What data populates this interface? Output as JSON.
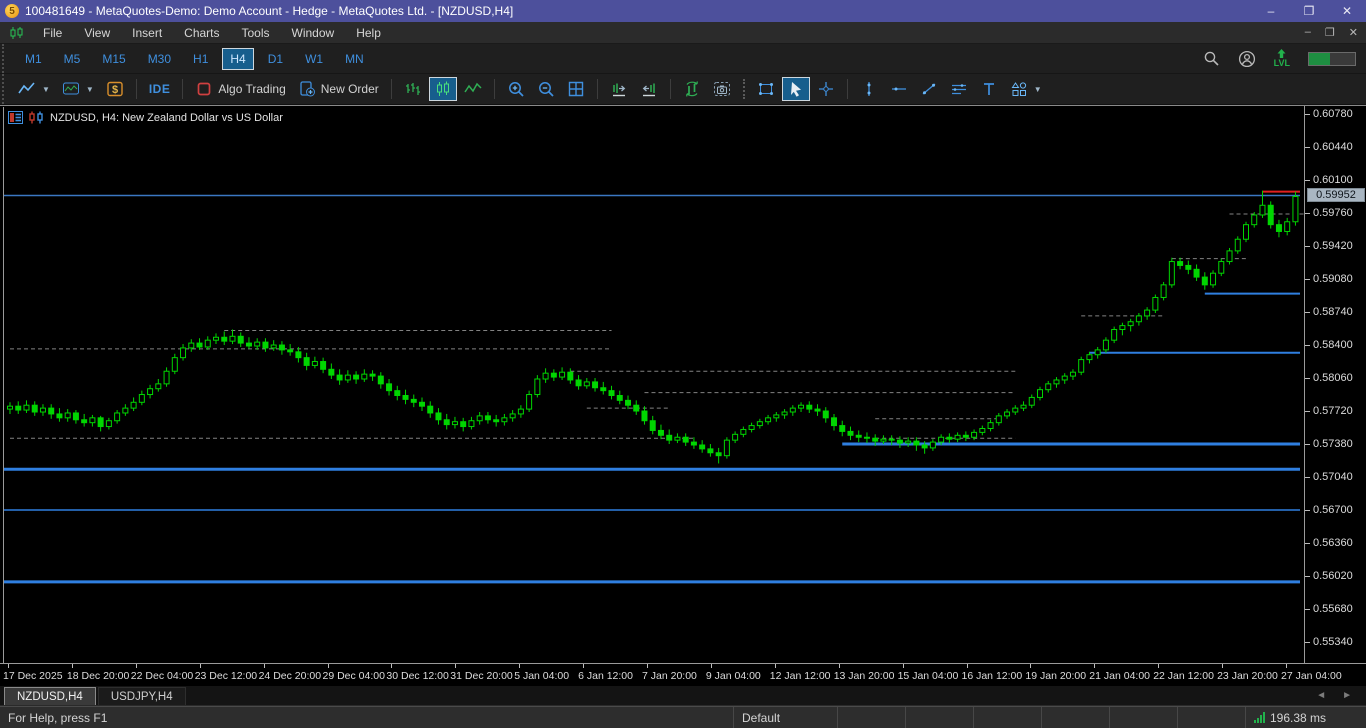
{
  "title_bar": {
    "title": "100481649 - MetaQuotes-Demo: Demo Account - Hedge - MetaQuotes Ltd. - [NZDUSD,H4]",
    "app_logo_text": "5",
    "controls": [
      "–",
      "❐",
      "✕"
    ]
  },
  "menu_bar": {
    "items": [
      "File",
      "View",
      "Insert",
      "Charts",
      "Tools",
      "Window",
      "Help"
    ],
    "child_controls": [
      "–",
      "❐",
      "✕"
    ]
  },
  "timeframe_bar": {
    "items": [
      "M1",
      "M5",
      "M15",
      "M30",
      "H1",
      "H4",
      "D1",
      "W1",
      "MN"
    ],
    "active": "H4"
  },
  "toolbar": {
    "items": [
      {
        "icon": "chart-type-icon",
        "dropdown": true
      },
      {
        "icon": "indicators-icon",
        "dropdown": true
      },
      {
        "icon": "dollar-icon"
      },
      {
        "sep": "line"
      },
      {
        "label": "IDE",
        "name": "ide-button",
        "label_class": "ide-label"
      },
      {
        "sep": "line"
      },
      {
        "icon": "algo-trading-icon",
        "label": "Algo Trading",
        "name": "algo-trading-button"
      },
      {
        "icon": "new-order-icon",
        "label": "New Order",
        "name": "new-order-button"
      },
      {
        "sep": "line"
      },
      {
        "icon": "bars-icon"
      },
      {
        "icon": "candles-icon",
        "active": true
      },
      {
        "icon": "line-chart-icon"
      },
      {
        "sep": "line"
      },
      {
        "icon": "zoom-in-icon"
      },
      {
        "icon": "zoom-out-icon"
      },
      {
        "icon": "tile-windows-icon"
      },
      {
        "sep": "line"
      },
      {
        "icon": "shift-end-icon"
      },
      {
        "icon": "shift-left-icon"
      },
      {
        "sep": "line"
      },
      {
        "icon": "auto-scroll-icon"
      },
      {
        "icon": "camera-icon"
      },
      {
        "sep": "dotted"
      },
      {
        "icon": "select-rect-icon"
      },
      {
        "icon": "cursor-icon",
        "active": true
      },
      {
        "icon": "crosshair-icon"
      },
      {
        "sep": "line"
      },
      {
        "icon": "vertical-line-icon"
      },
      {
        "icon": "horizontal-line-icon"
      },
      {
        "icon": "trendline-icon"
      },
      {
        "icon": "channel-icon"
      },
      {
        "icon": "text-icon"
      },
      {
        "icon": "shapes-icon",
        "dropdown": true
      }
    ],
    "right_icons": [
      "search-icon",
      "profile-icon"
    ],
    "level_label": "LVL",
    "progress_percent": 45
  },
  "chart": {
    "header": "NZDUSD, H4:  New Zealand Dollar vs US Dollar",
    "header_icons": [
      "depth-of-market-icon",
      "one-click-trading-icon"
    ],
    "price_badge": "0.59952",
    "colors": {
      "background": "#000000",
      "bull_fill": "#000000",
      "candle_green": "#00d600",
      "level_blue": "#2f7fe0",
      "current_price_blue": "#3b77c2",
      "alert_red": "#e02020",
      "dashed_gray": "#9a9a9a",
      "badge_bg": "#a9b6c2"
    }
  },
  "chart_data": {
    "type": "candlestick",
    "symbol": "NZDUSD",
    "timeframe": "H4",
    "price_axis": {
      "max": 0.6078,
      "min": 0.5534,
      "step": 0.0034,
      "labels": [
        "0.60780",
        "0.60440",
        "0.60100",
        "0.59760",
        "0.59420",
        "0.59080",
        "0.58740",
        "0.58400",
        "0.58060",
        "0.57720",
        "0.57380",
        "0.57040",
        "0.56700",
        "0.56360",
        "0.56020",
        "0.55680",
        "0.55340"
      ]
    },
    "time_axis": {
      "labels": [
        "17 Dec 2025",
        "18 Dec 20:00",
        "22 Dec 04:00",
        "23 Dec 12:00",
        "24 Dec 20:00",
        "29 Dec 04:00",
        "30 Dec 12:00",
        "31 Dec 20:00",
        "5 Jan 04:00",
        "6 Jan 12:00",
        "7 Jan 20:00",
        "9 Jan 04:00",
        "12 Jan 12:00",
        "13 Jan 20:00",
        "15 Jan 04:00",
        "16 Jan 12:00",
        "19 Jan 20:00",
        "21 Jan 04:00",
        "22 Jan 12:00",
        "23 Jan 20:00",
        "27 Jan 04:00"
      ]
    },
    "current_price": 0.59952,
    "levels": [
      {
        "price": 0.5995,
        "i1": null,
        "i2": null,
        "color": "#3b77c2",
        "width": 1.5,
        "note": "current price line"
      },
      {
        "price": 0.5999,
        "i1": 152,
        "i2": null,
        "color": "#e02020",
        "width": 2,
        "note": "red alert segment"
      },
      {
        "price": 0.5894,
        "i1": 145,
        "i2": null,
        "color": "#2f7fe0",
        "width": 2
      },
      {
        "price": 0.5833,
        "i1": 131,
        "i2": null,
        "color": "#2f7fe0",
        "width": 2
      },
      {
        "price": 0.5739,
        "i1": 101,
        "i2": null,
        "color": "#2f7fe0",
        "width": 3
      },
      {
        "price": 0.5713,
        "i1": null,
        "i2": null,
        "color": "#2f7fe0",
        "width": 3
      },
      {
        "price": 0.5671,
        "i1": null,
        "i2": null,
        "color": "#2f7fe0",
        "width": 1.5
      },
      {
        "price": 0.5597,
        "i1": null,
        "i2": null,
        "color": "#2f7fe0",
        "width": 3
      }
    ],
    "dashed_segments": [
      {
        "price": 0.5856,
        "i1": 26,
        "i2": 73
      },
      {
        "price": 0.5837,
        "i1": 0,
        "i2": 73
      },
      {
        "price": 0.5814,
        "i1": 68,
        "i2": 122
      },
      {
        "price": 0.5792,
        "i1": 77,
        "i2": 122
      },
      {
        "price": 0.5776,
        "i1": 70,
        "i2": 80
      },
      {
        "price": 0.5745,
        "i1": 0,
        "i2": 83
      },
      {
        "price": 0.5765,
        "i1": 105,
        "i2": 120
      },
      {
        "price": 0.5745,
        "i1": 105,
        "i2": 122
      },
      {
        "price": 0.5871,
        "i1": 130,
        "i2": 140
      },
      {
        "price": 0.593,
        "i1": 141,
        "i2": 150
      },
      {
        "price": 0.5976,
        "i1": 148,
        "i2": 157
      }
    ],
    "candles": [
      [
        0.5775,
        0.5782,
        0.577,
        0.5778
      ],
      [
        0.5778,
        0.5783,
        0.577,
        0.5774
      ],
      [
        0.5774,
        0.5784,
        0.5771,
        0.5779
      ],
      [
        0.5779,
        0.5783,
        0.5768,
        0.5772
      ],
      [
        0.5772,
        0.578,
        0.5768,
        0.5776
      ],
      [
        0.5776,
        0.578,
        0.5765,
        0.577
      ],
      [
        0.577,
        0.5776,
        0.5762,
        0.5766
      ],
      [
        0.5766,
        0.5775,
        0.5762,
        0.5771
      ],
      [
        0.5771,
        0.5774,
        0.576,
        0.5764
      ],
      [
        0.5764,
        0.577,
        0.5757,
        0.5761
      ],
      [
        0.5761,
        0.5769,
        0.5757,
        0.5766
      ],
      [
        0.5766,
        0.5768,
        0.5752,
        0.5757
      ],
      [
        0.5757,
        0.5766,
        0.5754,
        0.5763
      ],
      [
        0.5763,
        0.5774,
        0.576,
        0.5771
      ],
      [
        0.5771,
        0.578,
        0.5768,
        0.5776
      ],
      [
        0.5776,
        0.5787,
        0.5773,
        0.5782
      ],
      [
        0.5782,
        0.5794,
        0.5779,
        0.579
      ],
      [
        0.579,
        0.58,
        0.5786,
        0.5796
      ],
      [
        0.5796,
        0.5806,
        0.5793,
        0.5801
      ],
      [
        0.5801,
        0.5818,
        0.5798,
        0.5814
      ],
      [
        0.5814,
        0.5832,
        0.5811,
        0.5828
      ],
      [
        0.5828,
        0.5842,
        0.5825,
        0.5838
      ],
      [
        0.5838,
        0.5847,
        0.5834,
        0.5843
      ],
      [
        0.5843,
        0.5848,
        0.5836,
        0.5839
      ],
      [
        0.5839,
        0.585,
        0.5836,
        0.5846
      ],
      [
        0.5846,
        0.5853,
        0.5842,
        0.5849
      ],
      [
        0.5849,
        0.5855,
        0.5841,
        0.5845
      ],
      [
        0.5845,
        0.5857,
        0.5842,
        0.585
      ],
      [
        0.585,
        0.5854,
        0.5839,
        0.5843
      ],
      [
        0.5843,
        0.5849,
        0.5837,
        0.584
      ],
      [
        0.584,
        0.5848,
        0.5836,
        0.5844
      ],
      [
        0.5844,
        0.5848,
        0.5834,
        0.5838
      ],
      [
        0.5838,
        0.5846,
        0.5835,
        0.5841
      ],
      [
        0.5841,
        0.5845,
        0.5831,
        0.5836
      ],
      [
        0.5836,
        0.5842,
        0.583,
        0.5834
      ],
      [
        0.5834,
        0.5839,
        0.5823,
        0.5828
      ],
      [
        0.5828,
        0.5833,
        0.5815,
        0.582
      ],
      [
        0.582,
        0.5829,
        0.5817,
        0.5824
      ],
      [
        0.5824,
        0.5828,
        0.5812,
        0.5816
      ],
      [
        0.5816,
        0.5822,
        0.5806,
        0.581
      ],
      [
        0.581,
        0.5816,
        0.58,
        0.5805
      ],
      [
        0.5805,
        0.5815,
        0.5802,
        0.581
      ],
      [
        0.581,
        0.5814,
        0.5801,
        0.5806
      ],
      [
        0.5806,
        0.5816,
        0.5803,
        0.5811
      ],
      [
        0.5811,
        0.5815,
        0.5804,
        0.5809
      ],
      [
        0.5809,
        0.5813,
        0.5796,
        0.5801
      ],
      [
        0.5801,
        0.5806,
        0.5789,
        0.5794
      ],
      [
        0.5794,
        0.5799,
        0.5784,
        0.5789
      ],
      [
        0.5789,
        0.5795,
        0.578,
        0.5785
      ],
      [
        0.5785,
        0.579,
        0.5777,
        0.5782
      ],
      [
        0.5782,
        0.5787,
        0.5773,
        0.5778
      ],
      [
        0.5778,
        0.5783,
        0.5766,
        0.5771
      ],
      [
        0.5771,
        0.5776,
        0.5759,
        0.5764
      ],
      [
        0.5764,
        0.577,
        0.5754,
        0.5759
      ],
      [
        0.5759,
        0.5767,
        0.5755,
        0.5762
      ],
      [
        0.5762,
        0.5766,
        0.5752,
        0.5757
      ],
      [
        0.5757,
        0.5767,
        0.5754,
        0.5763
      ],
      [
        0.5763,
        0.5772,
        0.5759,
        0.5768
      ],
      [
        0.5768,
        0.5772,
        0.576,
        0.5764
      ],
      [
        0.5764,
        0.5769,
        0.5757,
        0.5762
      ],
      [
        0.5762,
        0.577,
        0.5758,
        0.5766
      ],
      [
        0.5766,
        0.5774,
        0.5762,
        0.577
      ],
      [
        0.577,
        0.5779,
        0.5766,
        0.5775
      ],
      [
        0.5775,
        0.5794,
        0.5772,
        0.579
      ],
      [
        0.579,
        0.581,
        0.5787,
        0.5806
      ],
      [
        0.5806,
        0.5817,
        0.5802,
        0.5812
      ],
      [
        0.5812,
        0.5816,
        0.5804,
        0.5808
      ],
      [
        0.5808,
        0.5818,
        0.5805,
        0.5813
      ],
      [
        0.5813,
        0.5817,
        0.5801,
        0.5805
      ],
      [
        0.5805,
        0.581,
        0.5795,
        0.5799
      ],
      [
        0.5799,
        0.5807,
        0.5796,
        0.5803
      ],
      [
        0.5803,
        0.5807,
        0.5793,
        0.5797
      ],
      [
        0.5797,
        0.5803,
        0.579,
        0.5794
      ],
      [
        0.5794,
        0.5799,
        0.5785,
        0.5789
      ],
      [
        0.5789,
        0.5794,
        0.578,
        0.5784
      ],
      [
        0.5784,
        0.5789,
        0.5775,
        0.5779
      ],
      [
        0.5779,
        0.5784,
        0.5769,
        0.5773
      ],
      [
        0.5773,
        0.5778,
        0.5759,
        0.5763
      ],
      [
        0.5763,
        0.5768,
        0.5749,
        0.5753
      ],
      [
        0.5753,
        0.5759,
        0.5744,
        0.5748
      ],
      [
        0.5748,
        0.5754,
        0.5739,
        0.5743
      ],
      [
        0.5743,
        0.575,
        0.574,
        0.5746
      ],
      [
        0.5746,
        0.575,
        0.5737,
        0.5741
      ],
      [
        0.5741,
        0.5746,
        0.5734,
        0.5738
      ],
      [
        0.5738,
        0.5743,
        0.573,
        0.5734
      ],
      [
        0.5734,
        0.5739,
        0.5726,
        0.573
      ],
      [
        0.573,
        0.5735,
        0.5719,
        0.5727
      ],
      [
        0.5727,
        0.5746,
        0.5724,
        0.5743
      ],
      [
        0.5743,
        0.5752,
        0.574,
        0.5749
      ],
      [
        0.5749,
        0.5757,
        0.5746,
        0.5754
      ],
      [
        0.5754,
        0.5761,
        0.5751,
        0.5758
      ],
      [
        0.5758,
        0.5765,
        0.5755,
        0.5762
      ],
      [
        0.5762,
        0.5769,
        0.5759,
        0.5766
      ],
      [
        0.5766,
        0.5772,
        0.5762,
        0.5769
      ],
      [
        0.5769,
        0.5775,
        0.5765,
        0.5772
      ],
      [
        0.5772,
        0.5779,
        0.5768,
        0.5776
      ],
      [
        0.5776,
        0.5782,
        0.5772,
        0.5779
      ],
      [
        0.5779,
        0.5783,
        0.5771,
        0.5775
      ],
      [
        0.5775,
        0.578,
        0.5768,
        0.5773
      ],
      [
        0.5773,
        0.5777,
        0.5761,
        0.5766
      ],
      [
        0.5766,
        0.577,
        0.5753,
        0.5758
      ],
      [
        0.5758,
        0.5763,
        0.5747,
        0.5752
      ],
      [
        0.5752,
        0.5757,
        0.5743,
        0.5748
      ],
      [
        0.5748,
        0.5753,
        0.5741,
        0.5746
      ],
      [
        0.5746,
        0.5751,
        0.574,
        0.5745
      ],
      [
        0.5745,
        0.5749,
        0.5737,
        0.5742
      ],
      [
        0.5742,
        0.5748,
        0.5739,
        0.5744
      ],
      [
        0.5744,
        0.5748,
        0.5738,
        0.5743
      ],
      [
        0.5743,
        0.5747,
        0.5735,
        0.574
      ],
      [
        0.574,
        0.5746,
        0.5736,
        0.5742
      ],
      [
        0.5742,
        0.5746,
        0.5732,
        0.5738
      ],
      [
        0.5738,
        0.5742,
        0.5729,
        0.5735
      ],
      [
        0.5735,
        0.5744,
        0.5732,
        0.5741
      ],
      [
        0.5741,
        0.5749,
        0.5738,
        0.5746
      ],
      [
        0.5746,
        0.575,
        0.574,
        0.5744
      ],
      [
        0.5744,
        0.5751,
        0.5741,
        0.5748
      ],
      [
        0.5748,
        0.5752,
        0.5742,
        0.5746
      ],
      [
        0.5746,
        0.5754,
        0.5743,
        0.5751
      ],
      [
        0.5751,
        0.5758,
        0.5748,
        0.5755
      ],
      [
        0.5755,
        0.5764,
        0.5752,
        0.5761
      ],
      [
        0.5761,
        0.5771,
        0.5758,
        0.5768
      ],
      [
        0.5768,
        0.5775,
        0.5765,
        0.5772
      ],
      [
        0.5772,
        0.5779,
        0.5769,
        0.5776
      ],
      [
        0.5776,
        0.5783,
        0.5773,
        0.5779
      ],
      [
        0.5779,
        0.579,
        0.5776,
        0.5787
      ],
      [
        0.5787,
        0.5798,
        0.5784,
        0.5795
      ],
      [
        0.5795,
        0.5804,
        0.5792,
        0.5801
      ],
      [
        0.5801,
        0.5808,
        0.5797,
        0.5805
      ],
      [
        0.5805,
        0.5812,
        0.5801,
        0.5809
      ],
      [
        0.5809,
        0.5816,
        0.5805,
        0.5813
      ],
      [
        0.5813,
        0.5829,
        0.581,
        0.5826
      ],
      [
        0.5826,
        0.5834,
        0.5822,
        0.5831
      ],
      [
        0.5831,
        0.5839,
        0.5827,
        0.5836
      ],
      [
        0.5836,
        0.5849,
        0.5833,
        0.5846
      ],
      [
        0.5846,
        0.586,
        0.5843,
        0.5857
      ],
      [
        0.5857,
        0.5864,
        0.5851,
        0.5861
      ],
      [
        0.5861,
        0.5868,
        0.5855,
        0.5865
      ],
      [
        0.5865,
        0.5874,
        0.5861,
        0.5871
      ],
      [
        0.5871,
        0.588,
        0.5867,
        0.5877
      ],
      [
        0.5877,
        0.5893,
        0.5874,
        0.589
      ],
      [
        0.589,
        0.5906,
        0.5887,
        0.5903
      ],
      [
        0.5903,
        0.5931,
        0.59,
        0.5927
      ],
      [
        0.5927,
        0.5931,
        0.5919,
        0.5923
      ],
      [
        0.5923,
        0.5928,
        0.5914,
        0.5919
      ],
      [
        0.5919,
        0.5924,
        0.5907,
        0.5911
      ],
      [
        0.5911,
        0.5916,
        0.5898,
        0.5903
      ],
      [
        0.5903,
        0.5918,
        0.59,
        0.5915
      ],
      [
        0.5915,
        0.593,
        0.5912,
        0.5927
      ],
      [
        0.5927,
        0.5941,
        0.5924,
        0.5938
      ],
      [
        0.5938,
        0.5953,
        0.5935,
        0.595
      ],
      [
        0.595,
        0.5968,
        0.5947,
        0.5965
      ],
      [
        0.5965,
        0.5978,
        0.5962,
        0.5975
      ],
      [
        0.5975,
        0.6,
        0.5972,
        0.5985
      ],
      [
        0.5985,
        0.5989,
        0.5961,
        0.5965
      ],
      [
        0.5965,
        0.597,
        0.5952,
        0.5958
      ],
      [
        0.5958,
        0.5972,
        0.5954,
        0.5968
      ],
      [
        0.5968,
        0.5999,
        0.5964,
        0.5994
      ]
    ]
  },
  "tabs": {
    "items": [
      {
        "label": "NZDUSD,H4",
        "active": true
      },
      {
        "label": "USDJPY,H4",
        "active": false
      }
    ],
    "arrows": [
      "◄",
      "►"
    ]
  },
  "status_bar": {
    "help": "For Help, press F1",
    "cells": [
      "Default",
      "",
      "",
      "",
      "",
      "",
      ""
    ],
    "ping": "196.38 ms"
  }
}
